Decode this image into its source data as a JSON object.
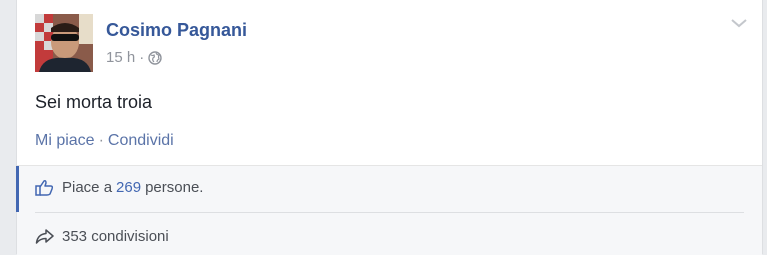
{
  "post": {
    "author": "Cosimo Pagnani",
    "time": "15 h",
    "separator": "·",
    "privacy_icon": "globe-icon",
    "menu_icon": "chevron-down-icon",
    "text": "Sei morta troia"
  },
  "actions": {
    "like_label": "Mi piace",
    "separator": "·",
    "share_label": "Condividi"
  },
  "footer": {
    "likes_prefix": "Piace a",
    "likes_count": "269",
    "likes_suffix": "persone.",
    "likes_icon": "thumbs-up-icon",
    "shares_text": "353 condivisioni",
    "shares_icon": "share-arrow-icon"
  },
  "colors": {
    "link": "#365899",
    "accent": "#4267b2",
    "meta": "#90949c",
    "background": "#e9ebee"
  }
}
